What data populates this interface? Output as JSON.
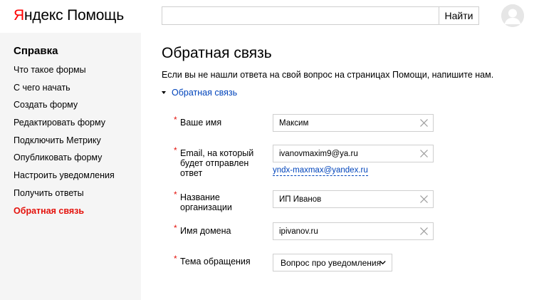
{
  "header": {
    "logo_brand_first": "Я",
    "logo_brand_rest": "ндекс",
    "logo_service": "Помощь",
    "search_value": "",
    "search_button_label": "Найти"
  },
  "sidebar": {
    "title": "Справка",
    "items": [
      {
        "label": "Что такое формы",
        "active": false
      },
      {
        "label": "С чего начать",
        "active": false
      },
      {
        "label": "Создать форму",
        "active": false
      },
      {
        "label": "Редактировать форму",
        "active": false
      },
      {
        "label": "Подключить Метрику",
        "active": false
      },
      {
        "label": "Опубликовать форму",
        "active": false
      },
      {
        "label": "Настроить уведомления",
        "active": false
      },
      {
        "label": "Получить ответы",
        "active": false
      },
      {
        "label": "Обратная связь",
        "active": true
      }
    ]
  },
  "main": {
    "title": "Обратная связь",
    "intro": "Если вы не нашли ответа на свой вопрос на страницах Помощи, напишите нам.",
    "section_toggle_label": "Обратная связь",
    "form": {
      "required_mark": "*",
      "name": {
        "label": "Ваше имя",
        "value": "Максим"
      },
      "email": {
        "label_lines": [
          "Email, на который",
          "будет отправлен",
          "ответ"
        ],
        "value": "ivanovmaxim9@ya.ru",
        "suggestion": "yndx-maxmax@yandex.ru"
      },
      "organization": {
        "label_lines": [
          "Название",
          "организации"
        ],
        "value": "ИП Иванов"
      },
      "domain": {
        "label": "Имя домена",
        "value": "ipivanov.ru"
      },
      "topic": {
        "label": "Тема обращения",
        "value": "Вопрос про уведомления"
      }
    }
  },
  "colors": {
    "brand_red": "#ff0000",
    "required_red": "#e4120c",
    "link_blue": "#0044bb",
    "sidebar_bg": "#f5f5f5",
    "border_gray": "#cfcfcf"
  },
  "icons": {
    "clear": "close-icon",
    "select_arrow": "chevron-down-icon",
    "toggle": "caret-down-icon",
    "avatar": "user-avatar-icon"
  }
}
